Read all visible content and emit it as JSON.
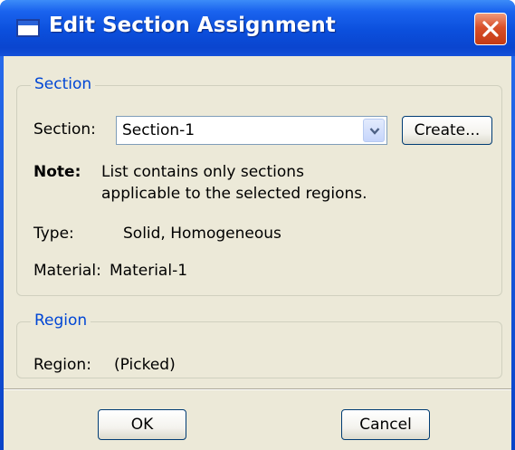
{
  "window": {
    "title": "Edit Section Assignment",
    "icon": "window-icon",
    "close_icon": "close-icon"
  },
  "section_group": {
    "legend": "Section",
    "section_label": "Section:",
    "section_value": "Section-1",
    "create_button": "Create...",
    "note_label": "Note:",
    "note_line1": "List contains only sections",
    "note_line2": "applicable to the selected regions.",
    "type_label": "Type:",
    "type_value": "Solid, Homogeneous",
    "material_label": "Material:",
    "material_value": "Material-1"
  },
  "region_group": {
    "legend": "Region",
    "region_label": "Region:",
    "region_value": "(Picked)"
  },
  "buttons": {
    "ok": "OK",
    "cancel": "Cancel"
  },
  "colors": {
    "titlebar": "#0a45cf",
    "client_bg": "#ece9d8",
    "legend_text": "#0046d5",
    "close_button": "#d8502a"
  }
}
